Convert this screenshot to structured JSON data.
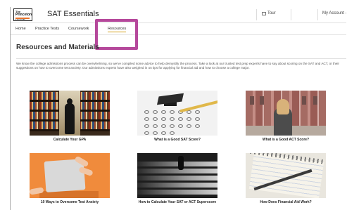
{
  "app": {
    "logo_lines": [
      "The",
      "Princeton",
      "Review"
    ],
    "title": "SAT Essentials"
  },
  "header": {
    "tour_label": "Tour",
    "account_label": "My Account"
  },
  "nav": {
    "items": [
      {
        "label": "Home"
      },
      {
        "label": "Practice Tests"
      },
      {
        "label": "Coursework"
      },
      {
        "label": "Resources"
      }
    ],
    "active_index": 3
  },
  "annotation": {
    "color": "#b5489b"
  },
  "page": {
    "title": "Resources and Materials",
    "intro": "We know the college admissions process can be overwhelming, so we've compiled some advice to help demystify the process. Take a look at our trusted test prep experts have to say about scoring on the SAT and ACT, or their suggestions on how to overcome test anxiety. Our admissions experts have also weighed in on tips for applying for financial aid and how to choose a college major."
  },
  "resources": [
    {
      "title": "Calculate Your GPA",
      "image": "library-student-photo"
    },
    {
      "title": "What is a Good SAT Score?",
      "image": "graduation-cap-test-sheet-photo"
    },
    {
      "title": "What is a Good ACT Score?",
      "image": "campus-student-photo"
    },
    {
      "title": "10 Ways to Overcome Test Anxiety",
      "image": "laptop-hands-photo"
    },
    {
      "title": "How to Calculate Your SAT or ACT Superscore",
      "image": "stairs-photo"
    },
    {
      "title": "How Does Financial Aid Work?",
      "image": "notebook-pencil-photo"
    }
  ]
}
